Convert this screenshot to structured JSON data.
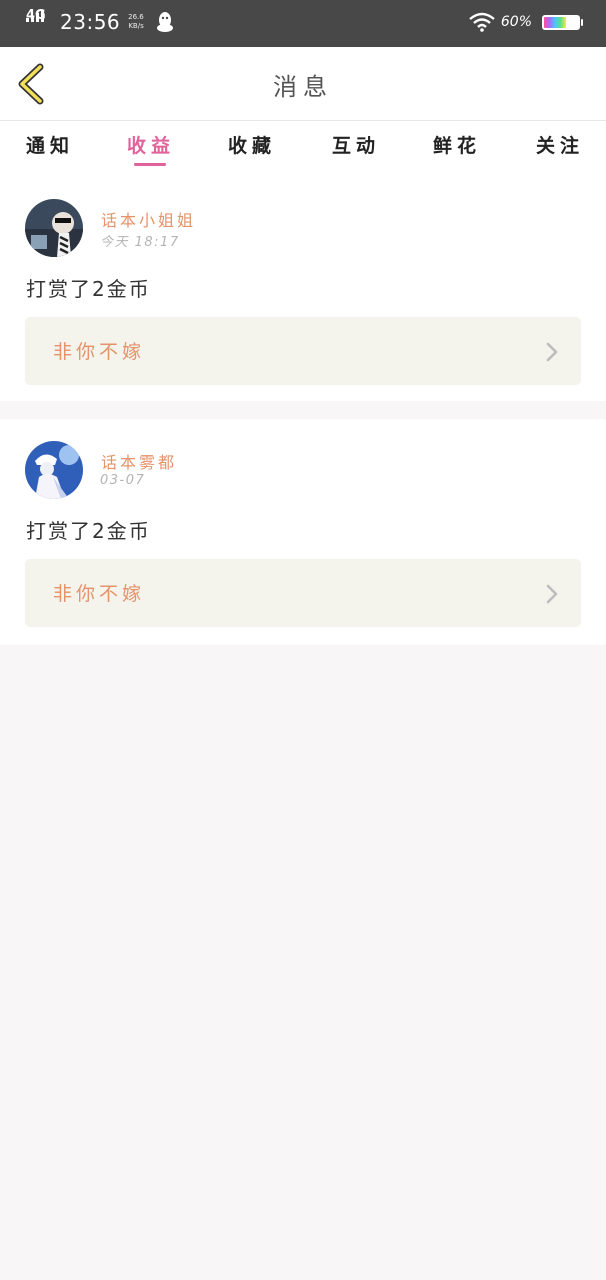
{
  "status_bar": {
    "network": "4G",
    "time": "23:56",
    "speed_value": "26.6",
    "speed_unit": "KB/s",
    "battery_text": "60%",
    "battery_level": 0.6
  },
  "header": {
    "title": "消息"
  },
  "tabs": [
    {
      "label": "通知"
    },
    {
      "label": "收益"
    },
    {
      "label": "收藏"
    },
    {
      "label": "互动"
    },
    {
      "label": "鲜花"
    },
    {
      "label": "关注"
    }
  ],
  "active_tab": "收益",
  "messages": [
    {
      "user": "话本小姐姐",
      "time": "今天 18:17",
      "text": "打赏了2金币",
      "book": "非你不嫁"
    },
    {
      "user": "话本雾都",
      "time": "03-07",
      "text": "打赏了2金币",
      "book": "非你不嫁"
    }
  ],
  "colors": {
    "accent": "#e0639b",
    "name": "#e5936a",
    "status_bar": "#484848",
    "book_bg": "#f4f3ec"
  }
}
